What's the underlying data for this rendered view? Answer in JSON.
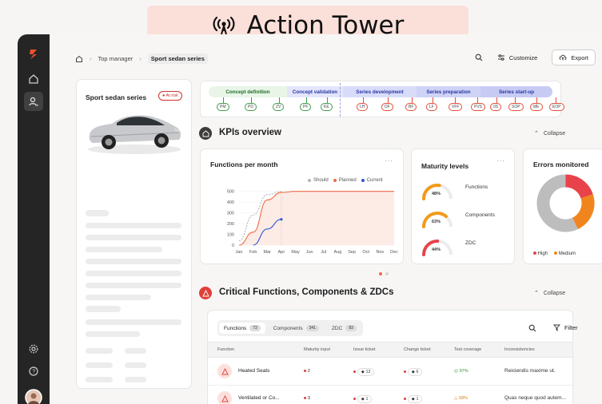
{
  "banner": {
    "title": "Action Tower",
    "icon": "broadcast-tower-icon"
  },
  "breadcrumb": {
    "home_icon": "home-icon",
    "items": [
      "Top manager",
      "Sport sedan series"
    ]
  },
  "toolbar": {
    "search_icon": "search-icon",
    "customize_label": "Customize",
    "export_label": "Export"
  },
  "sidebar": {
    "icons": [
      "logo-icon",
      "home-icon",
      "user-ai-icon",
      "settings-icon",
      "help-icon",
      "avatar"
    ]
  },
  "vehicle": {
    "name": "Sport sedan series",
    "status": "At risk"
  },
  "timeline": {
    "phases": [
      "Concept definition",
      "Concept validation",
      "Series development",
      "Series preparation",
      "Series start-up"
    ],
    "milestones": [
      "PM",
      "PD",
      "ZV",
      "PF",
      "KE",
      "LH",
      "DF",
      "BF",
      "LF",
      "VFF",
      "PVS",
      "0S",
      "SOP",
      "ME",
      "EOP"
    ]
  },
  "kpis": {
    "title": "KPIs overview",
    "collapse_label": "Collapse",
    "carousel_pages": 2,
    "active_page": 1
  },
  "functions_chart": {
    "title": "Functions per month",
    "more": "···"
  },
  "chart_data": {
    "type": "line",
    "categories": [
      "Jan",
      "Feb",
      "Mar",
      "Apr",
      "May",
      "Jun",
      "Jul",
      "Aug",
      "Sep",
      "Oct",
      "Nov",
      "Dec"
    ],
    "yticks": [
      0,
      100,
      200,
      300,
      400,
      500
    ],
    "ylim": [
      0,
      520
    ],
    "legend_position": "top-right",
    "series": [
      {
        "name": "Should",
        "color": "#b5b5b5",
        "dashed": true,
        "values": [
          40,
          280,
          470,
          500,
          null,
          null,
          null,
          null,
          null,
          null,
          null,
          null
        ]
      },
      {
        "name": "Planned",
        "color": "#ef6a48",
        "dashed": false,
        "values": [
          0,
          120,
          420,
          490,
          500,
          500,
          500,
          500,
          500,
          500,
          500,
          500
        ]
      },
      {
        "name": "Current",
        "color": "#2f56d8",
        "dashed": false,
        "values": [
          null,
          0,
          150,
          240,
          null,
          null,
          null,
          null,
          null,
          null,
          null,
          null
        ]
      }
    ]
  },
  "maturity": {
    "title": "Maturity levels",
    "more": "···",
    "items": [
      {
        "label": "Functions",
        "value": "48%",
        "fraction": 0.48
      },
      {
        "label": "Components",
        "value": "63%",
        "fraction": 0.63
      },
      {
        "label": "ZDC",
        "value": "44%",
        "fraction": 0.44
      }
    ]
  },
  "errors": {
    "title": "Errors monitored",
    "legend": [
      "High",
      "Medium"
    ],
    "segments": [
      {
        "name": "High",
        "share": 0.2,
        "color": "#e8434a"
      },
      {
        "name": "Medium",
        "share": 0.23,
        "color": "#f0851e"
      },
      {
        "name": "Other",
        "share": 0.57,
        "color": "#bdbdbd"
      }
    ]
  },
  "critical": {
    "title": "Critical Functions, Components & ZDCs",
    "collapse_label": "Collapse",
    "filter_label": "Filter",
    "tabs": [
      {
        "label": "Functions",
        "count": "73"
      },
      {
        "label": "Components",
        "count": "341"
      },
      {
        "label": "ZDC",
        "count": "83"
      }
    ],
    "columns": [
      "Function",
      "Maturity input",
      "Issue ticket",
      "Change ticket",
      "Test coverage",
      "Inconsistencies"
    ],
    "rows": [
      {
        "name": "Heated Seats",
        "maturity": "2",
        "issue": "13",
        "change": "6",
        "coverage": "97%",
        "inconsistency": "Reiciendis maxime ut."
      },
      {
        "name": "Ventilated or Co...",
        "maturity": "3",
        "issue": "1",
        "change": "1",
        "coverage": "68%",
        "inconsistency": "Quas neque quod autem..."
      }
    ]
  }
}
